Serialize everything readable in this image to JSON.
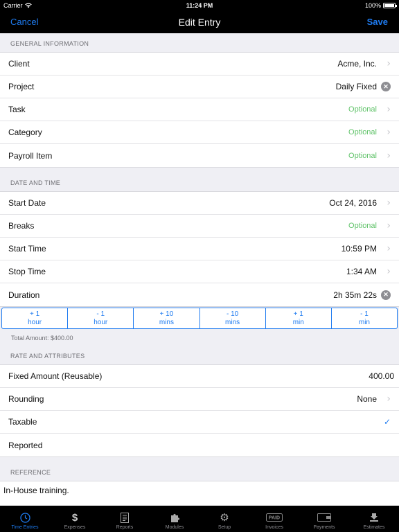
{
  "status_bar": {
    "carrier": "Carrier",
    "time": "11:24 PM",
    "battery": "100%"
  },
  "nav": {
    "cancel": "Cancel",
    "title": "Edit Entry",
    "save": "Save"
  },
  "general": {
    "header": "GENERAL INFORMATION",
    "client": {
      "label": "Client",
      "value": "Acme, Inc."
    },
    "project": {
      "label": "Project",
      "value": "Daily Fixed"
    },
    "task": {
      "label": "Task",
      "value": "Optional"
    },
    "category": {
      "label": "Category",
      "value": "Optional"
    },
    "payroll": {
      "label": "Payroll Item",
      "value": "Optional"
    }
  },
  "datetime": {
    "header": "DATE AND TIME",
    "start_date": {
      "label": "Start Date",
      "value": "Oct 24, 2016"
    },
    "breaks": {
      "label": "Breaks",
      "value": "Optional"
    },
    "start_time": {
      "label": "Start Time",
      "value": "10:59 PM"
    },
    "stop_time": {
      "label": "Stop Time",
      "value": "1:34 AM"
    },
    "duration": {
      "label": "Duration",
      "value": "2h 35m 22s"
    }
  },
  "stepper": [
    {
      "top": "+ 1",
      "bottom": "hour"
    },
    {
      "top": "- 1",
      "bottom": "hour"
    },
    {
      "top": "+ 10",
      "bottom": "mins"
    },
    {
      "top": "- 10",
      "bottom": "mins"
    },
    {
      "top": "+ 1",
      "bottom": "min"
    },
    {
      "top": "- 1",
      "bottom": "min"
    }
  ],
  "total_amount": "Total Amount: $400.00",
  "rate": {
    "header": "RATE AND ATTRIBUTES",
    "fixed_amount": {
      "label": "Fixed Amount (Reusable)",
      "value": "400.00"
    },
    "rounding": {
      "label": "Rounding",
      "value": "None"
    },
    "taxable": {
      "label": "Taxable",
      "checked": true
    },
    "reported": {
      "label": "Reported"
    }
  },
  "reference": {
    "header": "REFERENCE",
    "text": "In-House training."
  },
  "tabs": [
    {
      "label": "Time Entries",
      "icon": "clock-icon"
    },
    {
      "label": "Expenses",
      "icon": "dollar-icon"
    },
    {
      "label": "Reports",
      "icon": "report-icon"
    },
    {
      "label": "Modules",
      "icon": "puzzle-icon"
    },
    {
      "label": "Setup",
      "icon": "gear-icon"
    },
    {
      "label": "Invoices",
      "icon": "paid-stamp-icon"
    },
    {
      "label": "Payments",
      "icon": "wallet-icon"
    },
    {
      "label": "Estimates",
      "icon": "estimates-icon"
    }
  ],
  "colors": {
    "accent": "#1e7bf0",
    "optional": "#61c36a",
    "bar": "#000000",
    "background": "#efeff4"
  }
}
